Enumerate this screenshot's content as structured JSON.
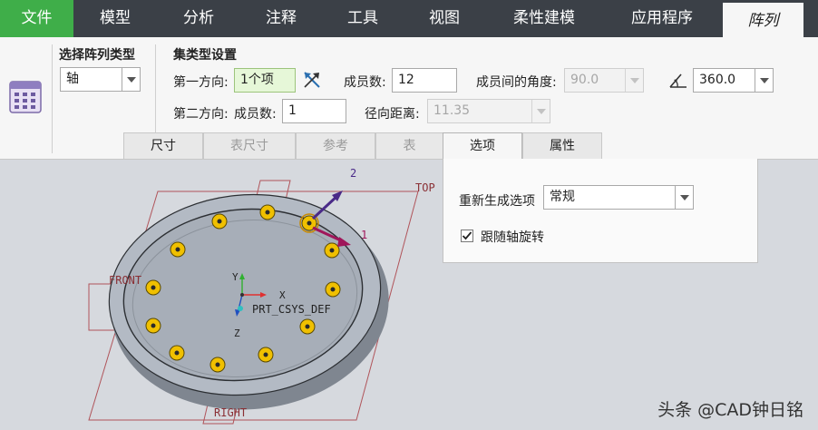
{
  "tabs": [
    {
      "label": "文件",
      "state": "file"
    },
    {
      "label": "模型",
      "state": "normal"
    },
    {
      "label": "分析",
      "state": "normal"
    },
    {
      "label": "注释",
      "state": "normal"
    },
    {
      "label": "工具",
      "state": "normal"
    },
    {
      "label": "视图",
      "state": "normal"
    },
    {
      "label": "柔性建模",
      "state": "normal"
    },
    {
      "label": "应用程序",
      "state": "normal"
    },
    {
      "label": "阵列",
      "state": "active"
    }
  ],
  "pattern_type": {
    "heading": "选择阵列类型",
    "value": "轴"
  },
  "set_settings": {
    "heading": "集类型设置",
    "first_direction": {
      "label": "第一方向:",
      "value": "1个项"
    },
    "member_count": {
      "label": "成员数:",
      "value": "12"
    },
    "angle_between": {
      "label": "成员间的角度:",
      "value": "90.0"
    },
    "total_angle": {
      "value": "360.0"
    },
    "second_direction": {
      "label": "第二方向:",
      "member_label": "成员数:",
      "value": "1"
    },
    "radial_distance": {
      "label": "径向距离:",
      "value": "11.35"
    }
  },
  "subtabs": [
    {
      "label": "尺寸",
      "state": "normal"
    },
    {
      "label": "表尺寸",
      "state": "disabled"
    },
    {
      "label": "参考",
      "state": "disabled"
    },
    {
      "label": "表",
      "state": "disabled"
    },
    {
      "label": "选项",
      "state": "active"
    },
    {
      "label": "属性",
      "state": "normal"
    }
  ],
  "options": {
    "regen_label": "重新生成选项",
    "regen_value": "常规",
    "follow_axis_label": "跟随轴旋转",
    "follow_axis_checked": true
  },
  "viewport": {
    "datum_top": "TOP",
    "datum_front": "FRONT",
    "datum_right": "RIGHT",
    "csys_label": "PRT_CSYS_DEF",
    "axis_x": "X",
    "axis_y": "Y",
    "axis_z": "Z",
    "dir_1": "1",
    "dir_2": "2"
  },
  "watermark": "头条 @CAD钟日铭",
  "colors": {
    "file_tab": "#3fae49",
    "tabbar": "#3b4047",
    "hole_yellow": "#f0c000",
    "part_gray": "#a9b0ba"
  }
}
